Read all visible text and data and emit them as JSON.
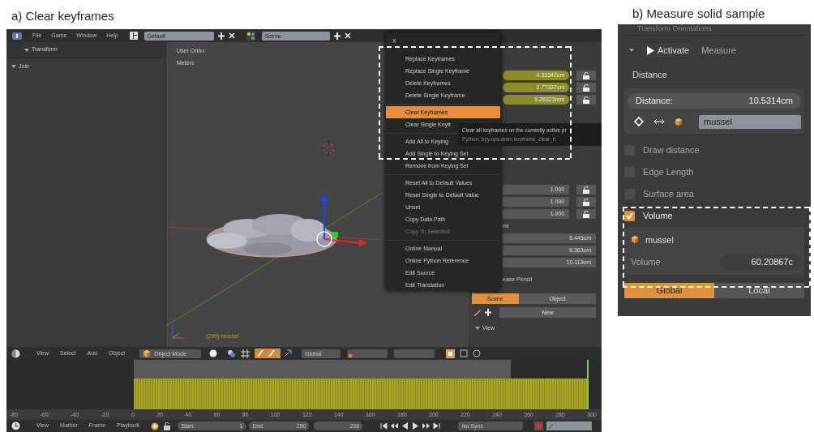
{
  "panel_a": {
    "caption": "a) Clear keyframes",
    "top_bar": {
      "menus": [
        "File",
        "Game",
        "Window",
        "Help"
      ],
      "layout_field": "Default",
      "scene_field": "Scene"
    },
    "tool_shelf": {
      "panels": [
        "Transform",
        "Join"
      ]
    },
    "viewport": {
      "view_label": "User Ortho",
      "units_label": "Meters",
      "object_label": "(299) mussel"
    },
    "properties": {
      "location_values": [
        "4.33342cm",
        "2.77337cm",
        "9.26323mm"
      ],
      "scale_values": [
        "1.000",
        "1.000",
        "1.000"
      ],
      "dimensions_heading": "ns",
      "dimension_values": [
        "8.443cm",
        "8.363cm",
        "10.113cm"
      ],
      "grease_pencil_heading": "ease Pencil",
      "grease_pencil_tabs": [
        {
          "label": "Scene",
          "selected": true
        },
        {
          "label": "Object",
          "selected": false
        }
      ],
      "new_button": "New",
      "view_heading": "View"
    },
    "context_menu": {
      "title": "X",
      "groups": [
        [
          {
            "label": "Replace Keyframes",
            "selected": false,
            "disabled": false
          },
          {
            "label": "Replace Single Keyframe",
            "selected": false,
            "disabled": false
          },
          {
            "label": "Delete Keyframes",
            "selected": false,
            "disabled": false
          },
          {
            "label": "Delete Single Keyframe",
            "selected": false,
            "disabled": false
          }
        ],
        [
          {
            "label": "Clear Keyframes",
            "selected": true,
            "disabled": false
          },
          {
            "label": "Clear Single Keyfr",
            "selected": false,
            "disabled": false
          }
        ],
        [
          {
            "label": "Add All to Keying",
            "selected": false,
            "disabled": false
          },
          {
            "label": "Add Single to Keying Set",
            "selected": false,
            "disabled": false
          },
          {
            "label": "Remove from Keying Set",
            "selected": false,
            "disabled": false
          }
        ],
        [
          {
            "label": "Reset All to Default Values",
            "selected": false,
            "disabled": false
          },
          {
            "label": "Reset Single to Default Value",
            "selected": false,
            "disabled": false
          },
          {
            "label": "Unset",
            "selected": false,
            "disabled": false
          },
          {
            "label": "Copy Data Path",
            "selected": false,
            "disabled": false
          },
          {
            "label": "Copy To Selected",
            "selected": false,
            "disabled": true
          }
        ],
        [
          {
            "label": "Online Manual",
            "selected": false,
            "disabled": false
          },
          {
            "label": "Online Python Reference",
            "selected": false,
            "disabled": false
          },
          {
            "label": "Edit Source",
            "selected": false,
            "disabled": false
          },
          {
            "label": "Edit Translation",
            "selected": false,
            "disabled": false
          }
        ]
      ]
    },
    "tooltip": {
      "text": "Clear all keyframes on the currently active pr",
      "python": "Python: bpy.ops.anim.keyframe_clear_b"
    },
    "view_header": {
      "menus": [
        "View",
        "Select",
        "Add",
        "Object"
      ],
      "mode": "Object Mode",
      "orientation": "Global"
    },
    "timeline": {
      "ticks": [
        "-80",
        "-60",
        "-40",
        "-20",
        "0",
        "20",
        "40",
        "60",
        "80",
        "100",
        "120",
        "140",
        "160",
        "180",
        "200",
        "220",
        "240",
        "260",
        "280",
        "300"
      ]
    },
    "timeline_header": {
      "menus": [
        "View",
        "Marker",
        "Frame",
        "Playback"
      ],
      "start_label": "Start:",
      "start": "1",
      "end_label": "End:",
      "end": "250",
      "current_frame": "299",
      "sync": "No Sync"
    }
  },
  "panel_b": {
    "caption": "b) Measure  solid sample",
    "header_cut": "Transform Orientations",
    "activate_button": "Activate",
    "title": "Measure",
    "section": "Distance",
    "distance_field": {
      "label": "Distance:",
      "value": "10.5314cm"
    },
    "object_field": "mussel",
    "options": [
      {
        "label": "Draw distance",
        "checked": false
      },
      {
        "label": "Edge Length",
        "checked": false
      },
      {
        "label": "Surface area",
        "checked": false
      },
      {
        "label": "Volume",
        "checked": true
      }
    ],
    "volume_box": {
      "object": "mussel",
      "label": "Volume",
      "value": "60.20867c"
    },
    "space_tabs": [
      {
        "label": "Global",
        "selected": true
      },
      {
        "label": "Local",
        "selected": false
      }
    ]
  }
}
